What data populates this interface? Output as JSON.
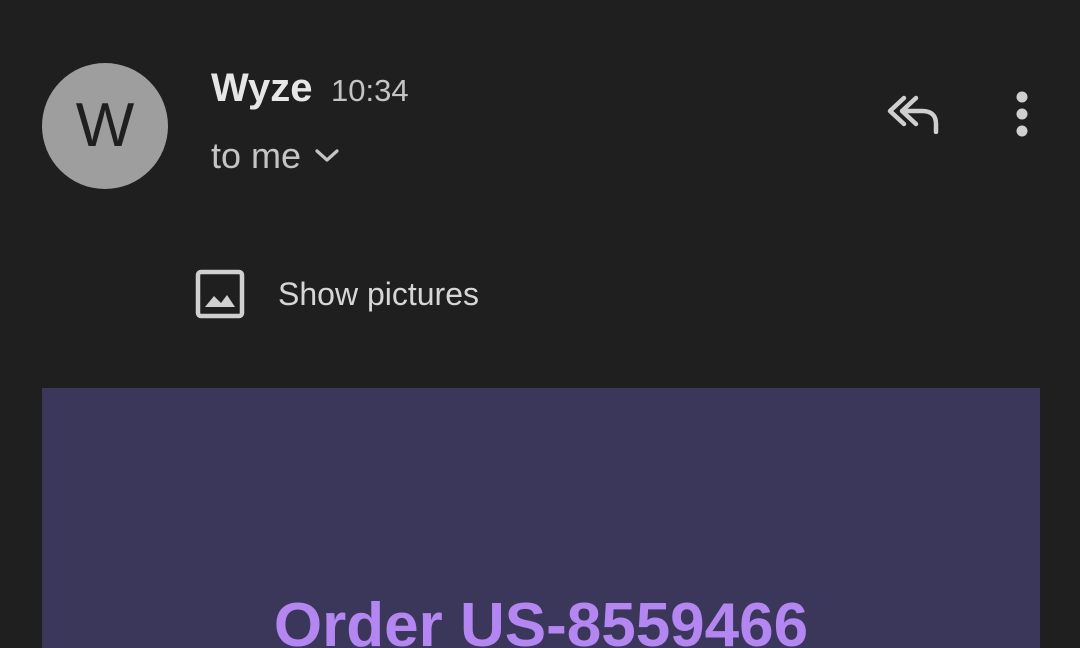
{
  "sender": {
    "avatar_letter": "W",
    "name": "Wyze",
    "time": "10:34"
  },
  "recipient": {
    "label": "to me"
  },
  "actions": {
    "reply_all_icon": "reply-all-icon",
    "more_icon": "more-vert-icon"
  },
  "images_notice": {
    "icon": "image-icon",
    "label": "Show pictures"
  },
  "email_body": {
    "heading": "Order US-8559466"
  },
  "colors": {
    "background": "#1f1f1f",
    "avatar": "#9e9e9e",
    "banner": "#3a375a",
    "heading": "#b486f2"
  }
}
